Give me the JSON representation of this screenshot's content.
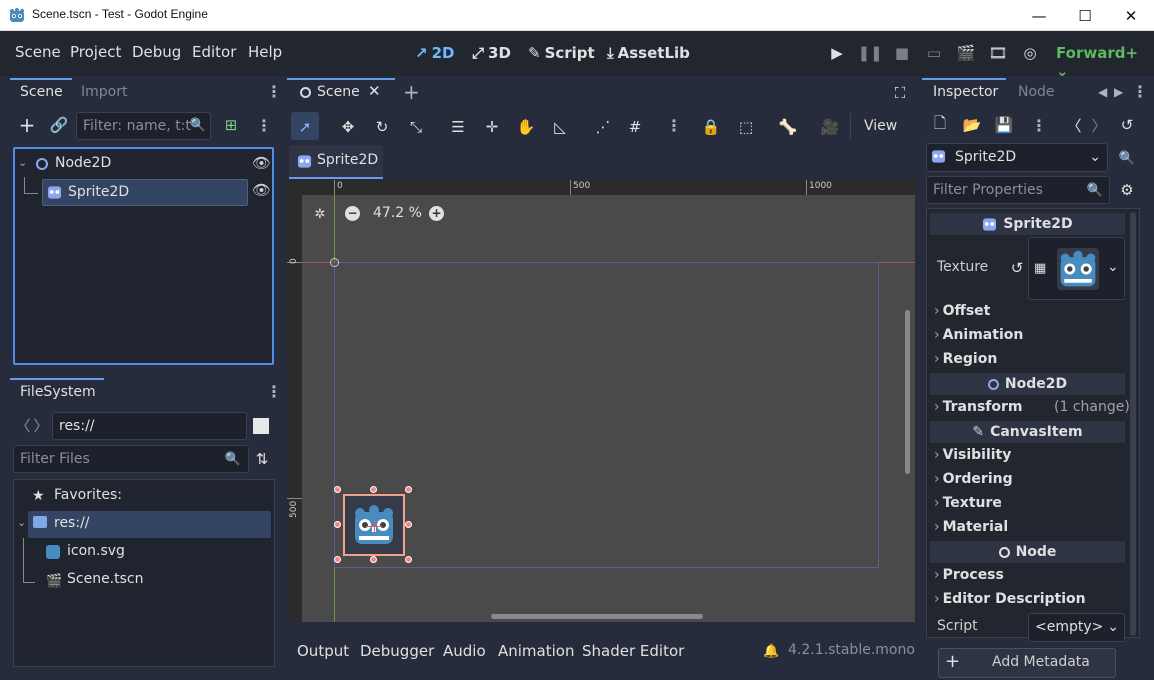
{
  "window": {
    "title": "Scene.tscn - Test - Godot Engine",
    "controls": {
      "minimize": "—",
      "maximize": "☐",
      "close": "✕"
    }
  },
  "menu": {
    "items": [
      "Scene",
      "Project",
      "Debug",
      "Editor",
      "Help"
    ],
    "workspaces": [
      "2D",
      "3D",
      "Script",
      "AssetLib"
    ],
    "renderer": "Forward+"
  },
  "scene_dock": {
    "tabs": [
      "Scene",
      "Import"
    ],
    "filter_placeholder": "Filter: name, t:t",
    "nodes": [
      {
        "name": "Node2D"
      },
      {
        "name": "Sprite2D"
      }
    ]
  },
  "filesystem": {
    "tab": "FileSystem",
    "path": "res://",
    "filter_placeholder": "Filter Files",
    "favorites_label": "Favorites:",
    "items": [
      {
        "name": "res://"
      },
      {
        "name": "icon.svg"
      },
      {
        "name": "Scene.tscn"
      }
    ]
  },
  "viewport": {
    "scene_tab": "Scene",
    "add_tab": "+",
    "view_menu": "View",
    "editing_tab": "Sprite2D",
    "zoom": "47.2 %",
    "ruler_h": [
      "0",
      "500",
      "1000"
    ],
    "ruler_v": [
      "0",
      "500"
    ]
  },
  "bottom_panel": {
    "tabs": [
      "Output",
      "Debugger",
      "Audio",
      "Animation",
      "Shader Editor"
    ],
    "version": "4.2.1.stable.mono"
  },
  "inspector": {
    "tabs": [
      "Inspector",
      "Node"
    ],
    "object": "Sprite2D",
    "filter_placeholder": "Filter Properties",
    "class_header": "Sprite2D",
    "texture_label": "Texture",
    "sections_sprite": [
      "Offset",
      "Animation",
      "Region"
    ],
    "node2d_header": "Node2D",
    "transform": {
      "label": "Transform",
      "note": "(1 change)"
    },
    "canvasitem_header": "CanvasItem",
    "sections_canvas": [
      "Visibility",
      "Ordering",
      "Texture",
      "Material"
    ],
    "node_header": "Node",
    "sections_node": [
      "Process",
      "Editor Description"
    ],
    "script_label": "Script",
    "script_value": "<empty>",
    "add_metadata": "Add Metadata"
  },
  "colors": {
    "accent": "#699ce8",
    "godot_blue": "#478cbf",
    "selection": "#334562"
  }
}
